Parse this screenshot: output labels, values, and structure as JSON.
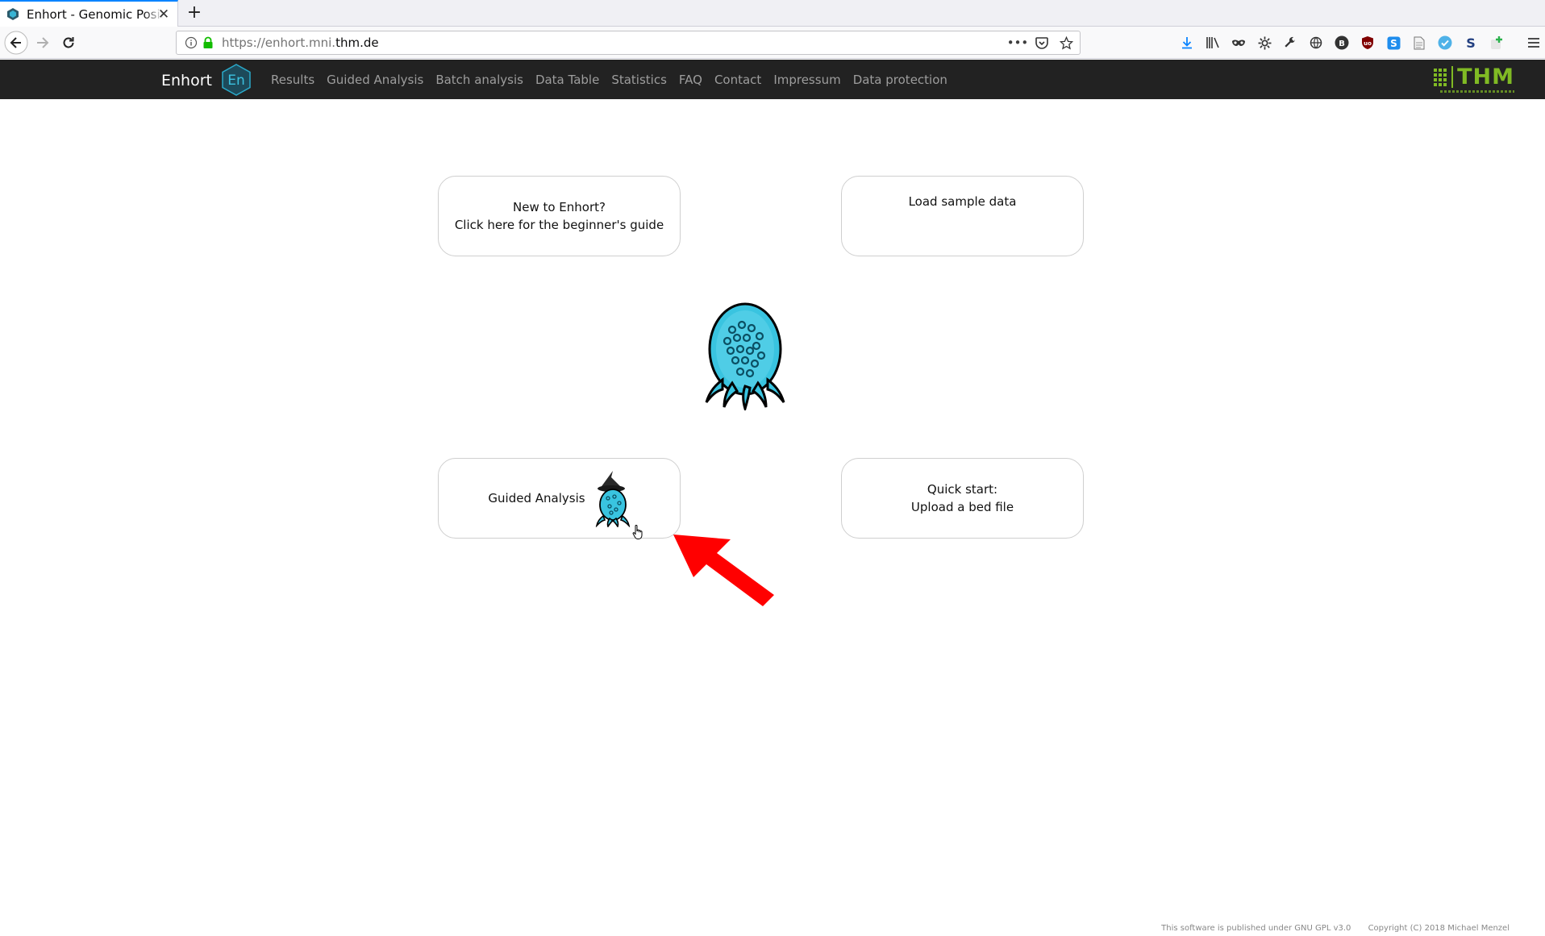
{
  "browser": {
    "tab_title": "Enhort - Genomic Position",
    "tab_close": "✕",
    "new_tab": "+",
    "url_prefix": "https://enhort.mni.",
    "url_domain": "thm.de",
    "url_action_more": "•••"
  },
  "site": {
    "brand": "Enhort",
    "brand_logo_text": "En",
    "menu": [
      "Results",
      "Guided Analysis",
      "Batch analysis",
      "Data Table",
      "Statistics",
      "FAQ",
      "Contact",
      "Impressum",
      "Data protection"
    ],
    "partner_logo": "THM",
    "brand_color": "#80ba24",
    "accent_color": "#2aa9c9"
  },
  "cards": {
    "beginner_line1": "New to Enhort?",
    "beginner_line2": "Click here for the beginner's guide",
    "sample": "Load sample data",
    "guided": "Guided Analysis",
    "quick_line1": "Quick start:",
    "quick_line2": "Upload a bed file"
  },
  "footer": {
    "license": "This software is published under GNU GPL v3.0",
    "copyright": "Copyright (C) 2018 Michael Menzel"
  },
  "annotation_arrow_color": "#ff0000"
}
